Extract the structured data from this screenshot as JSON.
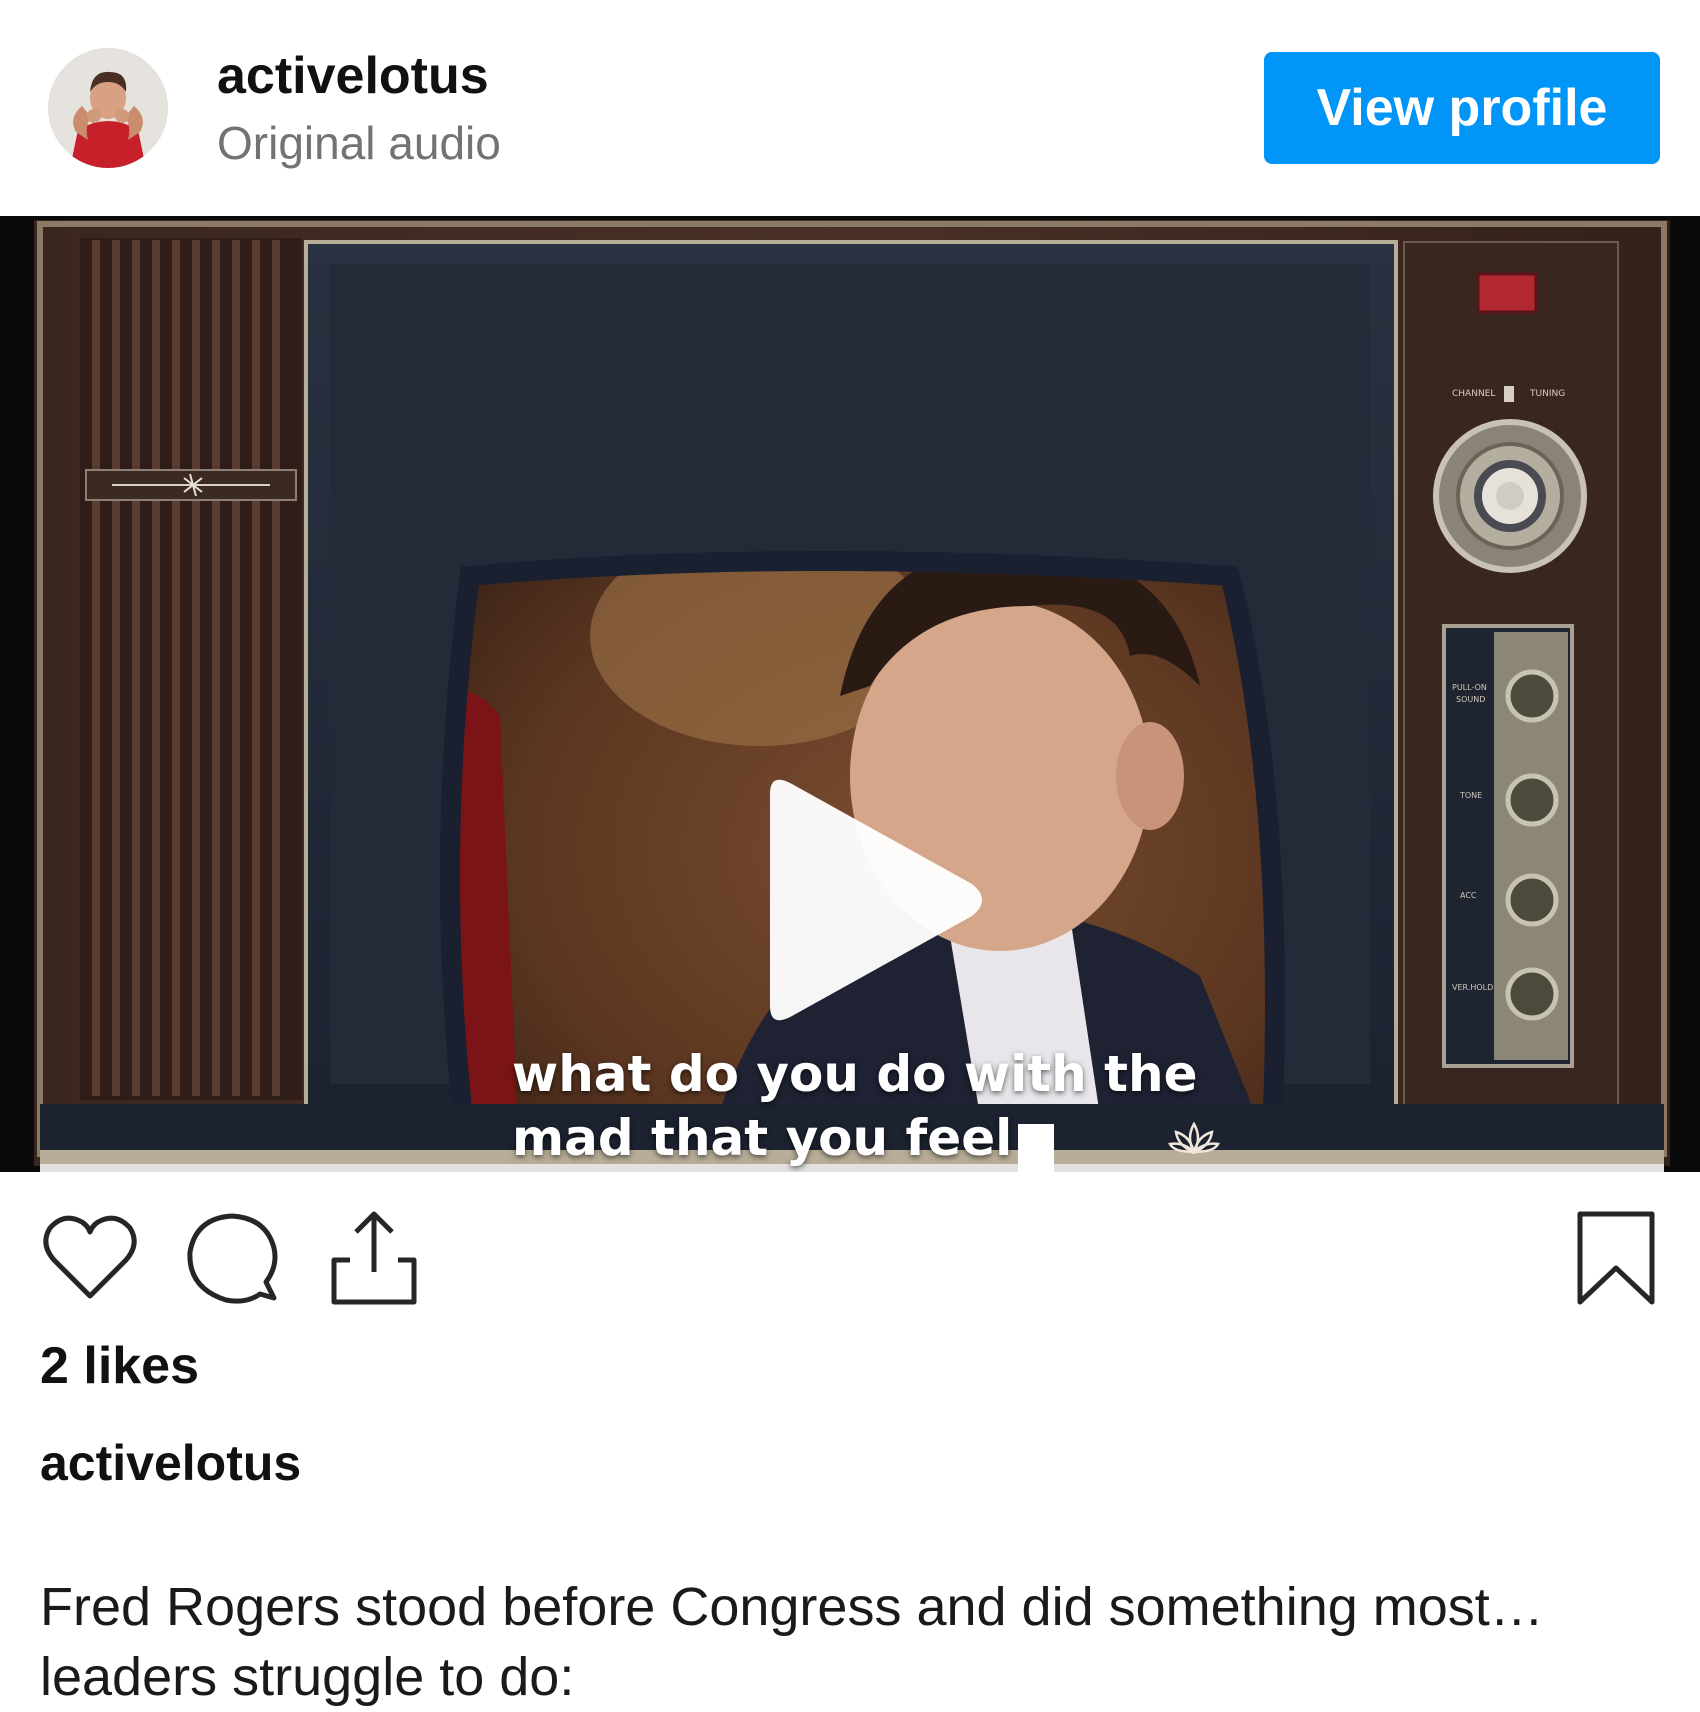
{
  "post": {
    "username": "activelotus",
    "audio_label": "Original audio",
    "view_profile_label": "View profile"
  },
  "video": {
    "caption_line_1": "what do you do with the",
    "caption_line_2": "mad that you feel",
    "play_icon": "play-icon",
    "watermark_icon": "lotus-icon"
  },
  "actions": {
    "icons": [
      "heart-icon",
      "comment-icon",
      "share-icon",
      "bookmark-icon"
    ]
  },
  "stats": {
    "likes_text": "2 likes"
  },
  "caption": {
    "username": "activelotus",
    "line_1": "Fred Rogers stood before Congress and did something most…",
    "line_2": "leaders struggle to do:"
  },
  "colors": {
    "accent": "#0095f6",
    "secondary_text": "#737373"
  }
}
